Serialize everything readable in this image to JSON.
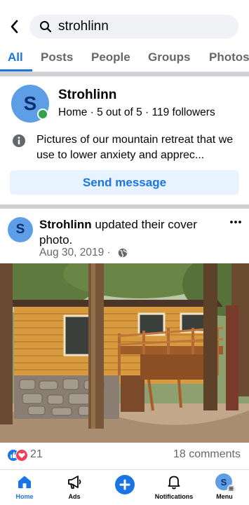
{
  "search": {
    "query": "strohlinn"
  },
  "tabs": [
    {
      "label": "All",
      "active": true
    },
    {
      "label": "Posts"
    },
    {
      "label": "People"
    },
    {
      "label": "Groups"
    },
    {
      "label": "Photos"
    }
  ],
  "page_result": {
    "avatar_letter": "S",
    "name": "Strohlinn",
    "meta": "Home · 5 out of 5 · 119 followers",
    "description": "Pictures of our mountain retreat that we use to lower anxiety and apprec...",
    "send_button": "Send message"
  },
  "post": {
    "avatar_letter": "S",
    "author": "Strohlinn",
    "action": " updated their cover photo.",
    "date": "Aug 30, 2019 ·",
    "reaction_count": "21",
    "comments": "18 comments"
  },
  "bottom_nav": [
    {
      "label": "Home",
      "icon": "home-icon",
      "active": true
    },
    {
      "label": "Ads",
      "icon": "megaphone-icon"
    },
    {
      "label": "",
      "icon": "create-plus-icon"
    },
    {
      "label": "Notifications",
      "icon": "bell-icon"
    },
    {
      "label": "Menu",
      "icon": "profile-menu-icon",
      "avatar_letter": "S"
    }
  ],
  "colors": {
    "accent": "#1b74e4",
    "avatar": "#5d9ee7",
    "online": "#31a24c",
    "like": "#1877f2",
    "love": "#f33e58"
  }
}
